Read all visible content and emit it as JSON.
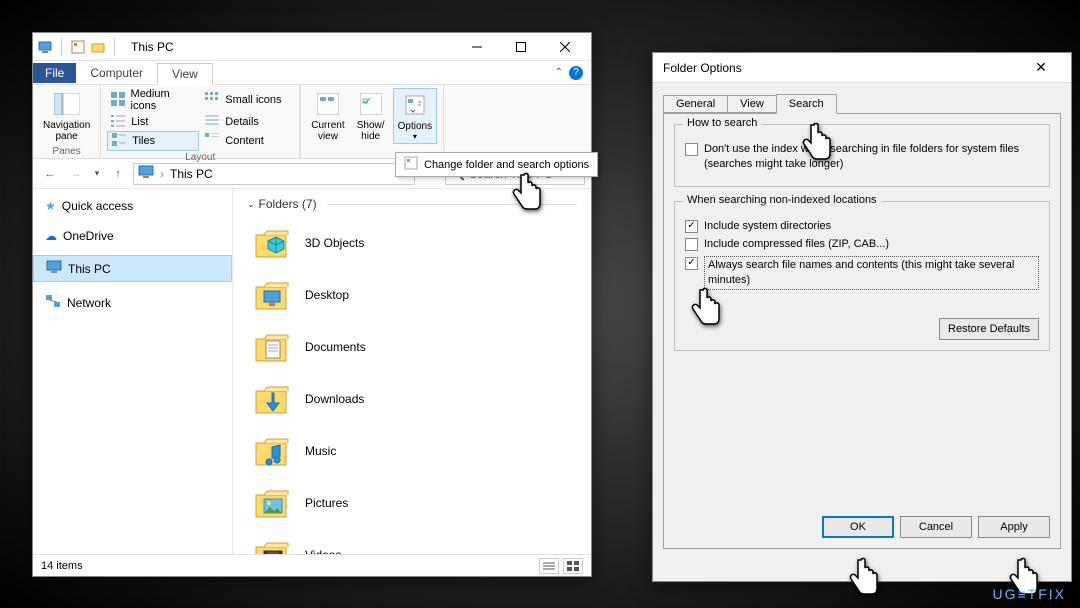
{
  "explorer": {
    "title": "This PC",
    "ribbon": {
      "file_tab": "File",
      "tabs": [
        "Computer",
        "View"
      ],
      "active_tab": "View",
      "panes_group": "Panes",
      "nav_pane": "Navigation\npane",
      "layout_group": "Layout",
      "layout_items": {
        "medium": "Medium icons",
        "small": "Small icons",
        "list": "List",
        "details": "Details",
        "tiles": "Tiles",
        "content": "Content"
      },
      "current_view": "Current\nview",
      "show_hide": "Show/\nhide",
      "options": "Options"
    },
    "tooltip": {
      "label": "Change folder and search options"
    },
    "breadcrumb": "This PC",
    "search_placeholder": "Search This PC",
    "nav_pane": {
      "quick_access": "Quick access",
      "onedrive": "OneDrive",
      "this_pc": "This PC",
      "network": "Network"
    },
    "folders_header": "Folders (7)",
    "folders": [
      {
        "name": "3D Objects",
        "icon": "3d"
      },
      {
        "name": "Desktop",
        "icon": "desktop"
      },
      {
        "name": "Documents",
        "icon": "documents"
      },
      {
        "name": "Downloads",
        "icon": "downloads"
      },
      {
        "name": "Music",
        "icon": "music"
      },
      {
        "name": "Pictures",
        "icon": "pictures"
      },
      {
        "name": "Videos",
        "icon": "videos"
      }
    ],
    "status": "14 items"
  },
  "folder_options": {
    "title": "Folder Options",
    "tabs": [
      "General",
      "View",
      "Search"
    ],
    "active_tab": "Search",
    "group1_title": "How to search",
    "chk_no_index": "Don't use the index when searching in file folders for system files (searches might take longer)",
    "group2_title": "When searching non-indexed locations",
    "chk_sys_dirs": "Include system directories",
    "chk_compressed": "Include compressed files (ZIP, CAB...)",
    "chk_always": "Always search file names and contents (this might take several minutes)",
    "restore_defaults": "Restore Defaults",
    "ok": "OK",
    "cancel": "Cancel",
    "apply": "Apply"
  },
  "watermark": "UG≡TFIX"
}
